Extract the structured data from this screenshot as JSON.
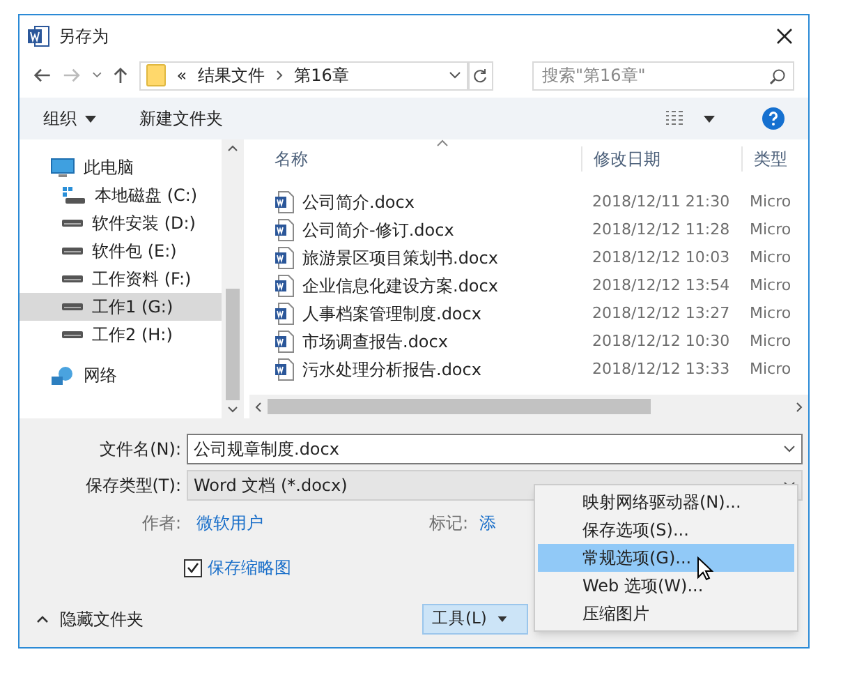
{
  "window": {
    "title": "另存为"
  },
  "address": {
    "path": [
      {
        "label": "«"
      },
      {
        "label": "结果文件"
      },
      {
        "label": "第16章"
      }
    ]
  },
  "search": {
    "placeholder": "搜索\"第16章\""
  },
  "toolbar": {
    "organize": "组织",
    "new_folder": "新建文件夹"
  },
  "sidebar": {
    "items": [
      {
        "label": "此电脑",
        "kind": "pc",
        "selected": false,
        "children": [
          {
            "label": "本地磁盘 (C:)",
            "kind": "system",
            "selected": false
          },
          {
            "label": "软件安装 (D:)",
            "kind": "drive",
            "selected": false
          },
          {
            "label": "软件包 (E:)",
            "kind": "drive",
            "selected": false
          },
          {
            "label": "工作资料 (F:)",
            "kind": "drive",
            "selected": false
          },
          {
            "label": "工作1 (G:)",
            "kind": "drive",
            "selected": true
          },
          {
            "label": "工作2 (H:)",
            "kind": "drive",
            "selected": false
          }
        ]
      },
      {
        "label": "网络",
        "kind": "network",
        "selected": false
      }
    ]
  },
  "table": {
    "columns": [
      "名称",
      "修改日期",
      "类型"
    ],
    "rows": [
      {
        "name": "公司简介.docx",
        "date": "2018/12/11 21:30",
        "type": "Micro"
      },
      {
        "name": "公司简介-修订.docx",
        "date": "2018/12/12 11:28",
        "type": "Micro"
      },
      {
        "name": "旅游景区项目策划书.docx",
        "date": "2018/12/12 10:03",
        "type": "Micro"
      },
      {
        "name": "企业信息化建设方案.docx",
        "date": "2018/12/12 13:54",
        "type": "Micro"
      },
      {
        "name": "人事档案管理制度.docx",
        "date": "2018/12/12 13:27",
        "type": "Micro"
      },
      {
        "name": "市场调查报告.docx",
        "date": "2018/12/12 10:30",
        "type": "Micro"
      },
      {
        "name": "污水处理分析报告.docx",
        "date": "2018/12/12 13:33",
        "type": "Micro"
      }
    ]
  },
  "form": {
    "filename_label": "文件名(N):",
    "filename": "公司规章制度.docx",
    "type_label": "保存类型(T):",
    "type": "Word 文档 (*.docx)",
    "author_label": "作者:",
    "author": "微软用户",
    "tags_label": "标记:",
    "tags": "添",
    "thumbnail": {
      "label": "保存缩略图",
      "checked": true
    }
  },
  "footer": {
    "hide_folders": "隐藏文件夹",
    "tools": "工具(L)"
  },
  "menu": {
    "items": [
      {
        "label": "映射网络驱动器(N)...",
        "selected": false
      },
      {
        "label": "保存选项(S)...",
        "selected": false
      },
      {
        "label": "常规选项(G)...",
        "selected": true
      },
      {
        "label": "Web 选项(W)...",
        "selected": false
      },
      {
        "label": "压缩图片",
        "selected": false
      }
    ]
  }
}
